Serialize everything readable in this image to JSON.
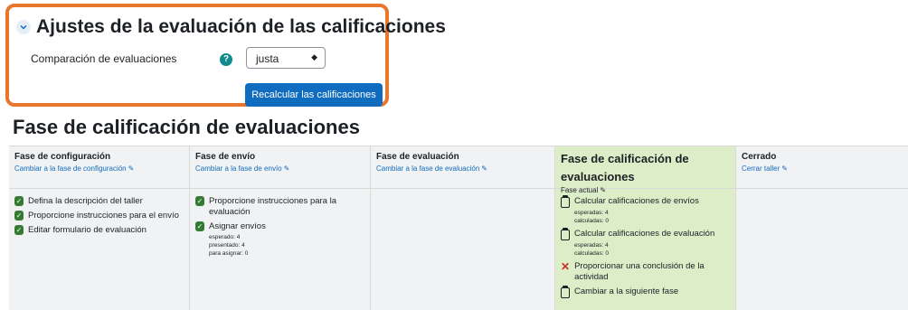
{
  "settings": {
    "title": "Ajustes de la evaluación de las calificaciones",
    "comparison_label": "Comparación de evaluaciones",
    "comparison_value": "justa",
    "recalc_button": "Recalcular las calificaciones",
    "accent_color": "#e8762d"
  },
  "page_title": "Fase de calificación de evaluaciones",
  "phases": [
    {
      "name": "Fase de configuración",
      "link": "Cambiar a la fase de configuración",
      "tasks": [
        "Defina la descripción del taller",
        "Proporcione instrucciones para el envío",
        "Editar formulario de evaluación"
      ]
    },
    {
      "name": "Fase de envío",
      "link": "Cambiar a la fase de envío",
      "tasks": [
        "Proporcione instrucciones para la evaluación",
        "Asignar envíos"
      ],
      "details": [
        "esperado: 4",
        "presentado: 4",
        "para asignar: 0"
      ]
    },
    {
      "name": "Fase de evaluación",
      "link": "Cambiar a la fase de evaluación"
    },
    {
      "name": "Fase de calificación de evaluaciones",
      "current_label": "Fase actual",
      "tasks": [
        "Calcular calificaciones de envíos",
        "Calcular calificaciones de evaluación",
        "Proporcionar una conclusión de la actividad",
        "Cambiar a la siguiente fase"
      ],
      "details_a": [
        "esperadas: 4",
        "calculadas: 0"
      ],
      "details_b": [
        "esperadas: 4",
        "calculadas: 0"
      ]
    },
    {
      "name": "Cerrado",
      "link": "Cerrar taller"
    }
  ]
}
